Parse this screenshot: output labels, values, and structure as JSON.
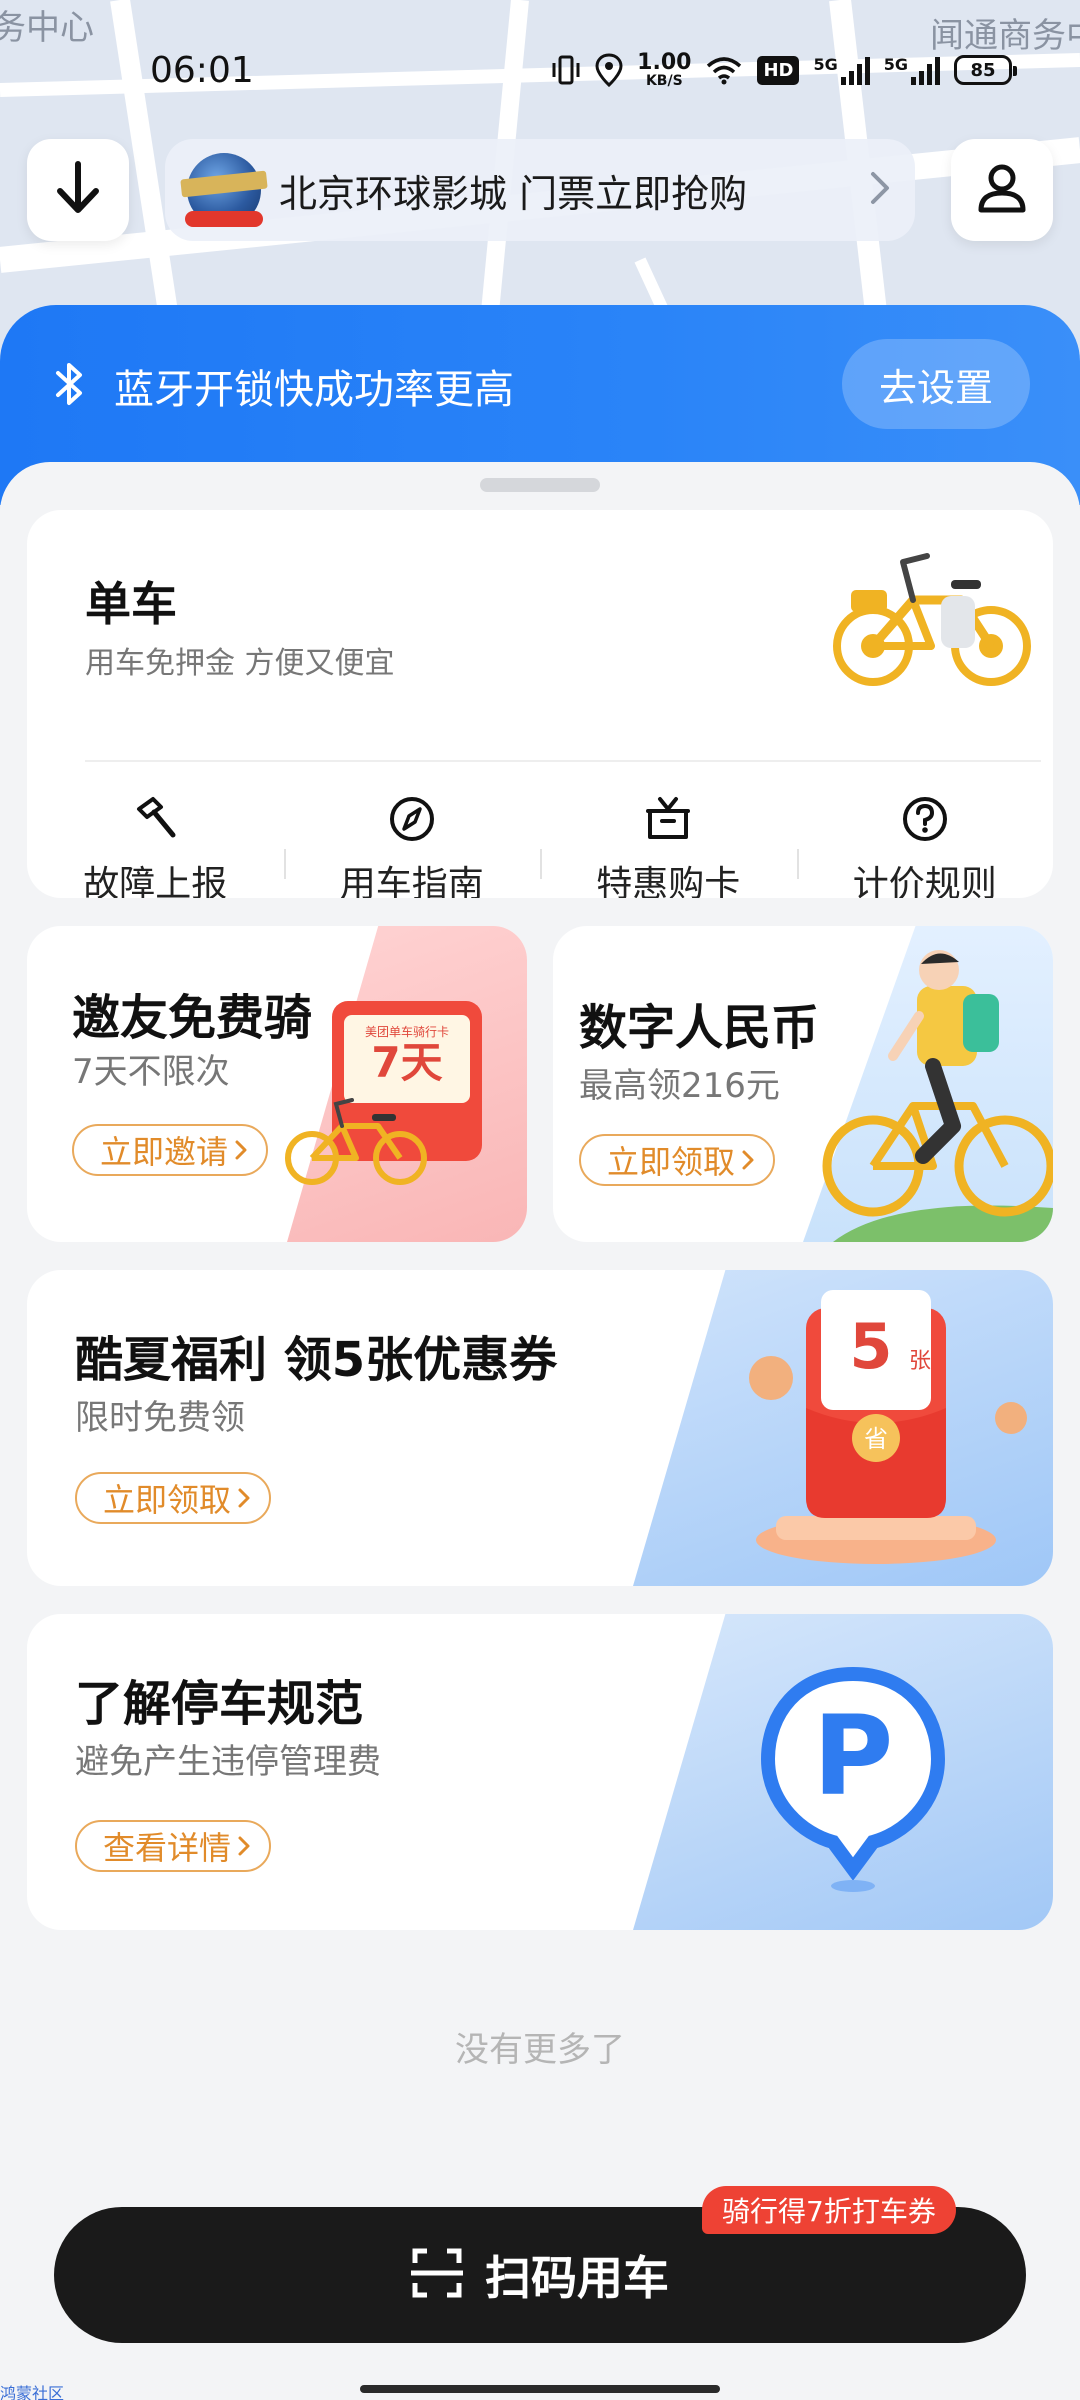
{
  "map": {
    "label_left": "务中心",
    "label_right": "闻通商务中"
  },
  "status_bar": {
    "time": "06:01",
    "net_speed_value": "1.00",
    "net_speed_unit": "KB/S",
    "hd_badge": "HD",
    "sim1_label": "5G",
    "sim2_label": "5G",
    "battery": "85"
  },
  "top": {
    "collapse_icon": "arrow-down-icon",
    "promo_text": "北京环球影城 门票立即抢购",
    "promo_logo": "universal-studios-logo",
    "profile_icon": "user-icon"
  },
  "bluetooth": {
    "text": "蓝牙开锁快成功率更高",
    "button": "去设置"
  },
  "bike_card": {
    "title": "单车",
    "subtitle": "用车免押金 方便又便宜",
    "actions": [
      {
        "label": "故障上报",
        "icon": "hammer-icon"
      },
      {
        "label": "用车指南",
        "icon": "compass-icon"
      },
      {
        "label": "特惠购卡",
        "icon": "gift-icon"
      },
      {
        "label": "计价规则",
        "icon": "question-icon"
      }
    ]
  },
  "cards": {
    "invite": {
      "title": "邀友免费骑",
      "subtitle": "7天不限次",
      "button": "立即邀请",
      "envelope_caption": "美团单车骑行卡",
      "envelope_value": "7天"
    },
    "rmb": {
      "title": "数字人民币",
      "subtitle": "最高领216元",
      "button": "立即领取"
    },
    "summer": {
      "title": "酷夏福利 领5张优惠券",
      "subtitle": "限时免费领",
      "button": "立即领取",
      "coupon_count": "5",
      "coupon_unit": "张",
      "coupon_seal": "省"
    },
    "parking": {
      "title": "了解停车规范",
      "subtitle": "避免产生违停管理费",
      "button": "查看详情",
      "badge_letter": "P"
    }
  },
  "footer": {
    "no_more": "没有更多了",
    "scan_label": "扫码用车",
    "scan_badge": "骑行得7折打车券",
    "watermark": "鸿蒙社区"
  },
  "colors": {
    "brand_blue": "#1e78f5",
    "accent_orange": "#e18b2a",
    "badge_red": "#ee4234",
    "scan_black": "#1a1a1a"
  }
}
